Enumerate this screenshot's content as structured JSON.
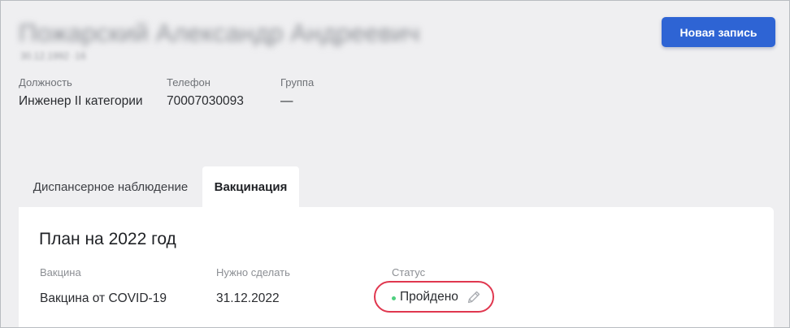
{
  "employee": {
    "name": "Пожарский Александр Андреевич",
    "birth_date": "30.12.1992 ·16"
  },
  "actions": {
    "new_record_label": "Новая запись"
  },
  "info": [
    {
      "label": "Должность",
      "value": "Инженер II категории"
    },
    {
      "label": "Телефон",
      "value": "70007030093"
    },
    {
      "label": "Группа",
      "value": "—"
    }
  ],
  "tabs": [
    {
      "label": "Диспансерное наблюдение",
      "active": false
    },
    {
      "label": "Вакцинация",
      "active": true
    }
  ],
  "plan": {
    "title": "План на 2022 год",
    "columns": {
      "vaccine": "Вакцина",
      "due": "Нужно сделать",
      "status": "Статус"
    },
    "rows": [
      {
        "vaccine": "Вакцина от COVID-19",
        "due": "31.12.2022",
        "status": "Пройдено",
        "status_color": "#4fcf7f",
        "edit_icon": "pencil-icon"
      }
    ]
  },
  "colors": {
    "primary_button": "#2e64d4",
    "highlight_outline": "#e0374f",
    "status_done": "#4fcf7f",
    "page_background": "#efeff1"
  }
}
